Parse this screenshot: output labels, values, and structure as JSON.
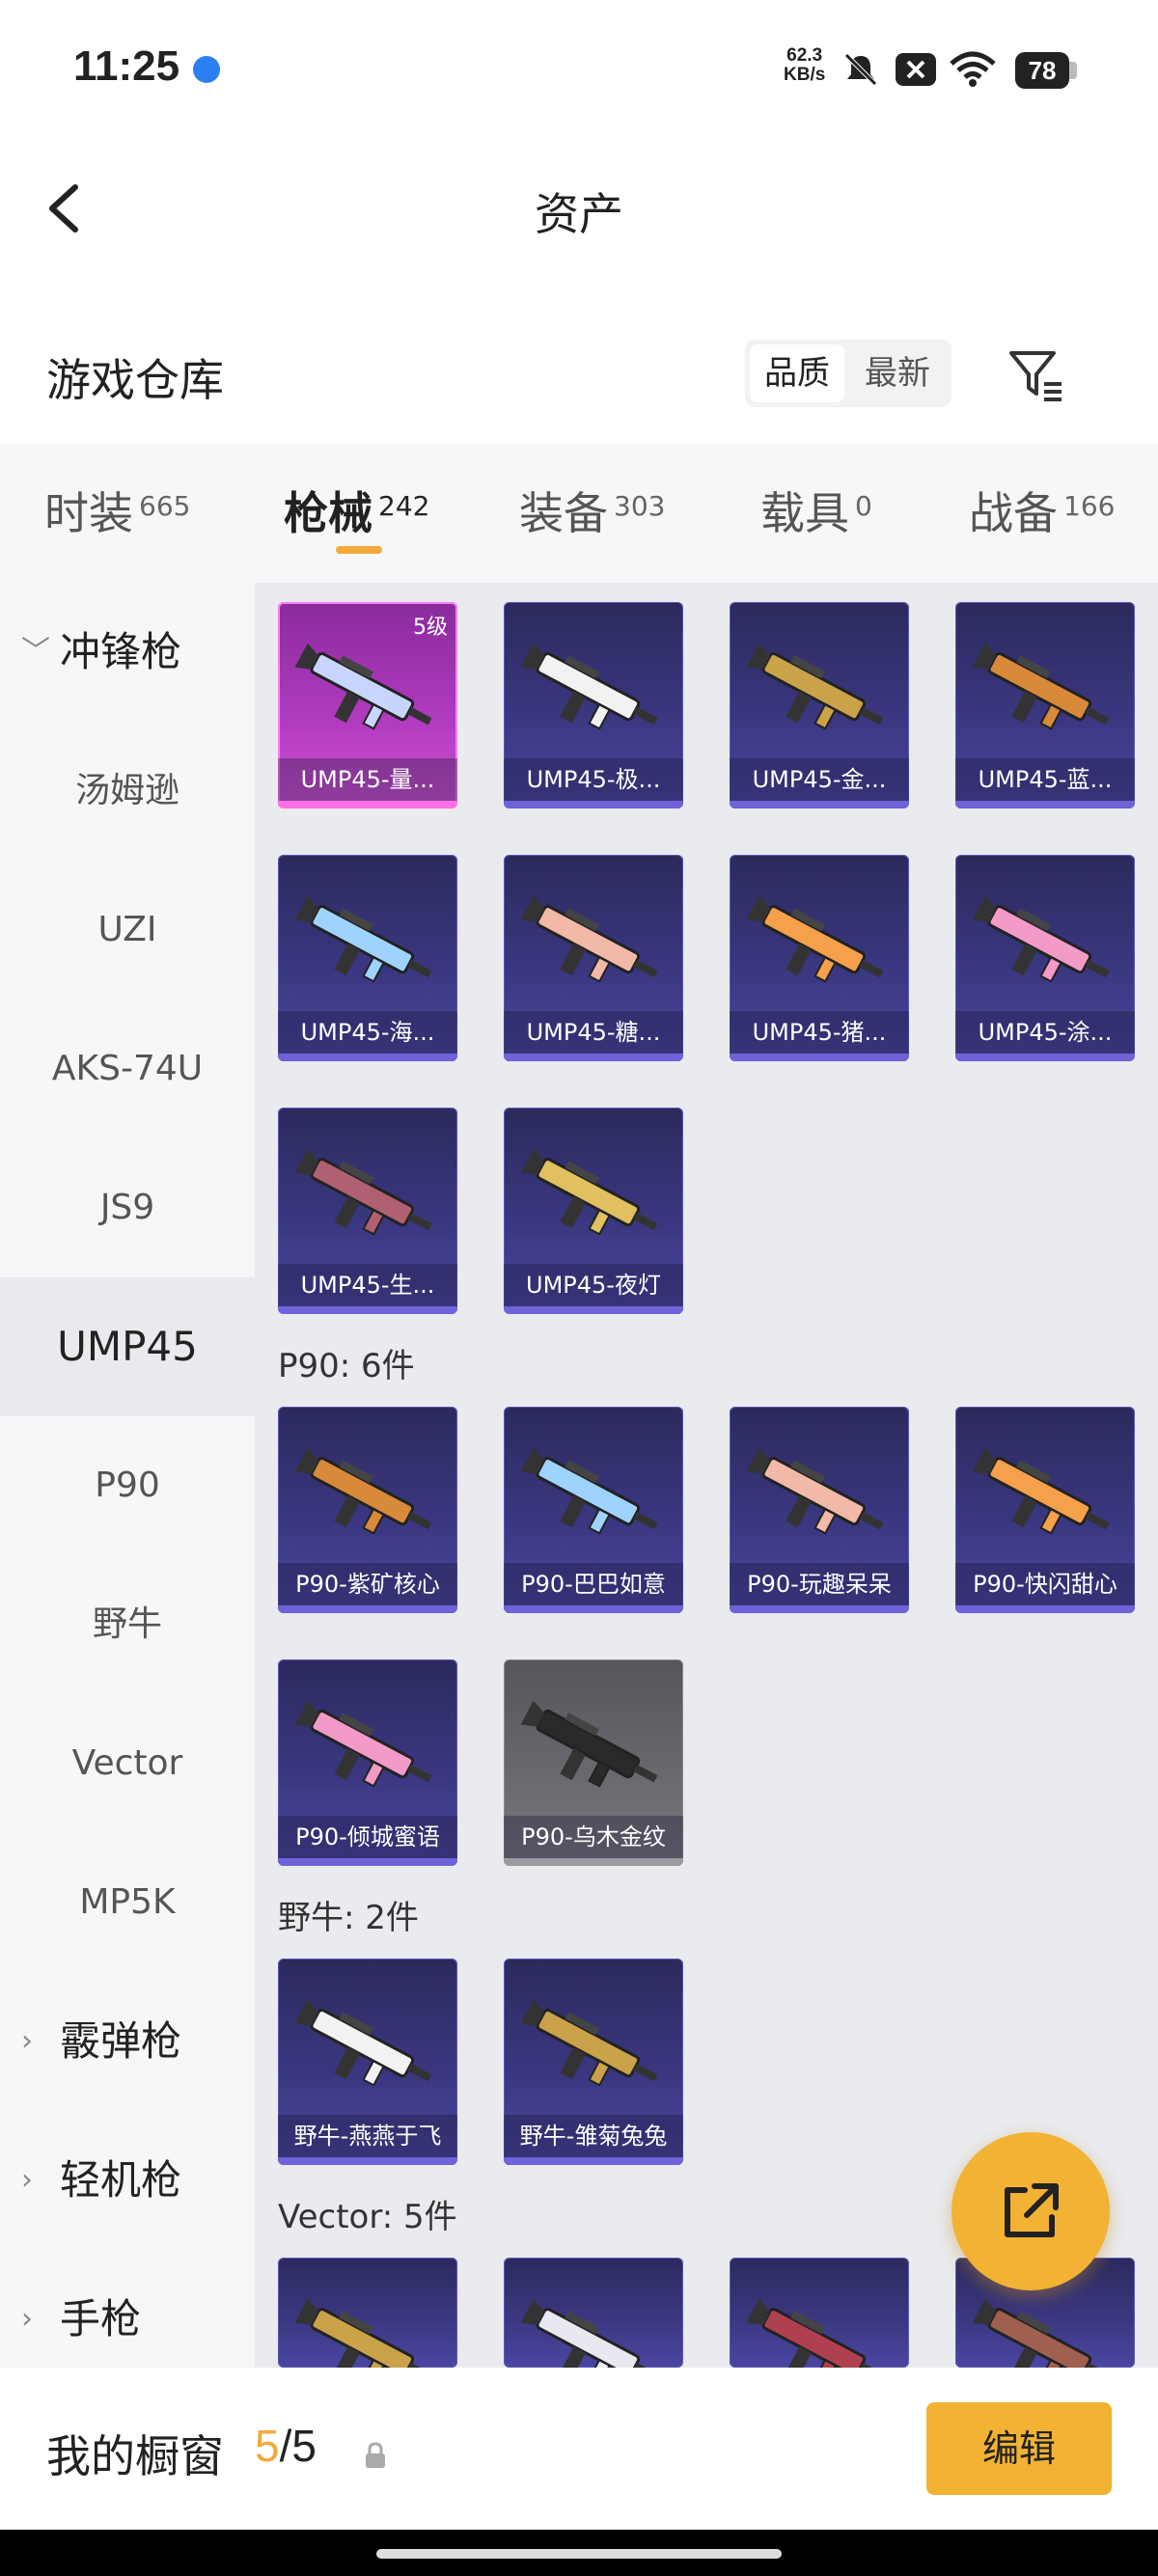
{
  "status_bar": {
    "time": "11:25",
    "net_speed_value": "62.3",
    "net_speed_unit": "KB/s",
    "battery": "78",
    "icons": [
      "browser-icon",
      "mute-icon",
      "no-sim-icon",
      "wifi-icon",
      "battery-icon"
    ]
  },
  "header": {
    "title": "资产",
    "back_icon": "back-arrow-icon"
  },
  "warehouse": {
    "title": "游戏仓库",
    "sort_options": [
      "品质",
      "最新"
    ],
    "sort_selected": "品质",
    "filter_icon": "filter-icon"
  },
  "tabs": [
    {
      "label": "时装",
      "count": "665"
    },
    {
      "label": "枪械",
      "count": "242"
    },
    {
      "label": "装备",
      "count": "303"
    },
    {
      "label": "载具",
      "count": "0"
    },
    {
      "label": "战备",
      "count": "166"
    }
  ],
  "active_tab": "枪械",
  "sidebar": {
    "groups": [
      {
        "label": "冲锋枪",
        "expanded": true
      },
      {
        "label": "霰弹枪",
        "expanded": false
      },
      {
        "label": "轻机枪",
        "expanded": false
      },
      {
        "label": "手枪",
        "expanded": false
      }
    ],
    "items": [
      "汤姆逊",
      "UZI",
      "AKS-74U",
      "JS9",
      "UMP45",
      "P90",
      "野牛",
      "Vector",
      "MP5K"
    ],
    "selected": "UMP45"
  },
  "sections": {
    "ump45": {
      "cards": [
        {
          "name": "UMP45-量...",
          "level": "5级",
          "quality": "legendary"
        },
        {
          "name": "UMP45-极...",
          "quality": "epic"
        },
        {
          "name": "UMP45-金...",
          "quality": "epic"
        },
        {
          "name": "UMP45-蓝...",
          "quality": "epic"
        },
        {
          "name": "UMP45-海...",
          "quality": "epic"
        },
        {
          "name": "UMP45-糖...",
          "quality": "epic"
        },
        {
          "name": "UMP45-猪...",
          "quality": "epic"
        },
        {
          "name": "UMP45-涂...",
          "quality": "epic"
        },
        {
          "name": "UMP45-生...",
          "quality": "epic"
        },
        {
          "name": "UMP45-夜灯",
          "quality": "epic"
        }
      ]
    },
    "p90": {
      "label": "P90: 6件",
      "cards": [
        {
          "name": "P90-紫矿核心",
          "quality": "epic"
        },
        {
          "name": "P90-巴巴如意",
          "quality": "epic"
        },
        {
          "name": "P90-玩趣呆呆",
          "quality": "epic"
        },
        {
          "name": "P90-快闪甜心",
          "quality": "epic"
        },
        {
          "name": "P90-倾城蜜语",
          "quality": "epic"
        },
        {
          "name": "P90-乌木金纹",
          "quality": "common"
        }
      ]
    },
    "bison": {
      "label": "野牛: 2件",
      "cards": [
        {
          "name": "野牛-燕燕于飞",
          "quality": "epic"
        },
        {
          "name": "野牛-雏菊兔兔",
          "quality": "epic"
        }
      ]
    },
    "vector": {
      "label": "Vector: 5件"
    }
  },
  "fab_icon": "share-external-icon",
  "showcase": {
    "label": "我的橱窗",
    "current": "5",
    "separator": "/",
    "total": "5",
    "lock_icon": "lock-icon",
    "edit_label": "编辑"
  },
  "colors": {
    "accent": "#F2B233",
    "tab_underline": "#F2A93B",
    "card_epic": "#3A3780",
    "card_legendary": "#B23CC0",
    "card_common": "#6A6A70"
  }
}
